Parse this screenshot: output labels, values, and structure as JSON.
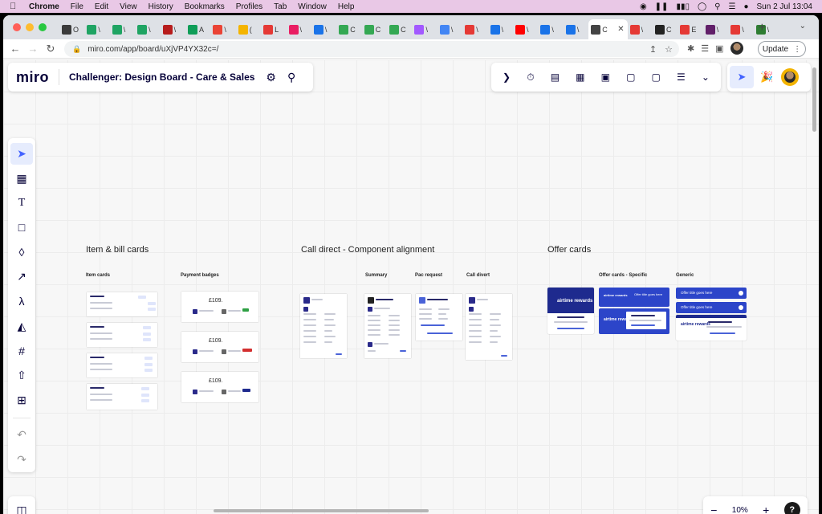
{
  "menubar": {
    "app": "Chrome",
    "items": [
      "File",
      "Edit",
      "View",
      "History",
      "Bookmarks",
      "Profiles",
      "Tab",
      "Window",
      "Help"
    ],
    "datetime": "Sun 2 Jul  13:04"
  },
  "browser": {
    "tabs": [
      {
        "label": "O",
        "color": "#3b3b3b"
      },
      {
        "label": "\\",
        "color": "#1fa463"
      },
      {
        "label": "\\",
        "color": "#1fa463"
      },
      {
        "label": "\\",
        "color": "#1fa463"
      },
      {
        "label": "\\",
        "color": "#b71c1c"
      },
      {
        "label": "A",
        "color": "#0f9d58"
      },
      {
        "label": "\\",
        "color": "#ea4335"
      },
      {
        "label": "(",
        "color": "#f4b400"
      },
      {
        "label": "L",
        "color": "#e53935"
      },
      {
        "label": "\\",
        "color": "#e91e63"
      },
      {
        "label": "\\",
        "color": "#1a73e8"
      },
      {
        "label": "C",
        "color": "#34a853"
      },
      {
        "label": "C",
        "color": "#34a853"
      },
      {
        "label": "C",
        "color": "#34a853"
      },
      {
        "label": "\\",
        "color": "#a259ff"
      },
      {
        "label": "\\",
        "color": "#4285f4"
      },
      {
        "label": "\\",
        "color": "#e53935"
      },
      {
        "label": "\\",
        "color": "#1a73e8"
      },
      {
        "label": "\\",
        "color": "#ff0000"
      },
      {
        "label": "\\",
        "color": "#1a73e8"
      },
      {
        "label": "\\",
        "color": "#1a73e8"
      },
      {
        "label": "C",
        "color": "#444444",
        "active": true
      },
      {
        "label": "\\",
        "color": "#e53935"
      },
      {
        "label": "C",
        "color": "#222222"
      },
      {
        "label": "E",
        "color": "#e53935"
      },
      {
        "label": "\\",
        "color": "#611f69"
      },
      {
        "label": "\\",
        "color": "#e53935"
      },
      {
        "label": "\\",
        "color": "#2e7d32"
      }
    ],
    "url": "miro.com/app/board/uXjVP4YX32c=/",
    "update_label": "Update"
  },
  "miro": {
    "logo": "miro",
    "board_title": "Challenger: Design Board - Care & Sales",
    "zoom": "10%",
    "help": "?"
  },
  "board": {
    "sections": [
      {
        "title": "Item & bill cards",
        "subs": [
          "Item cards",
          "Payment badges"
        ]
      },
      {
        "title": "Call direct -  Component alignment",
        "subs": [
          "Summary",
          "Pac request",
          "Call divert"
        ]
      },
      {
        "title": "Offer cards",
        "subs": [
          "Offer cards - Specific",
          "Generic"
        ]
      }
    ],
    "payment_price": "£109.",
    "offer_brand": "airtime rewards",
    "offer_title_placeholder": "Offer title goes here"
  },
  "colors": {
    "menubar": "#e9c8e6",
    "accent": "#4262ff",
    "miro_dark": "#050038",
    "offer_blue": "#1e2a8e"
  }
}
